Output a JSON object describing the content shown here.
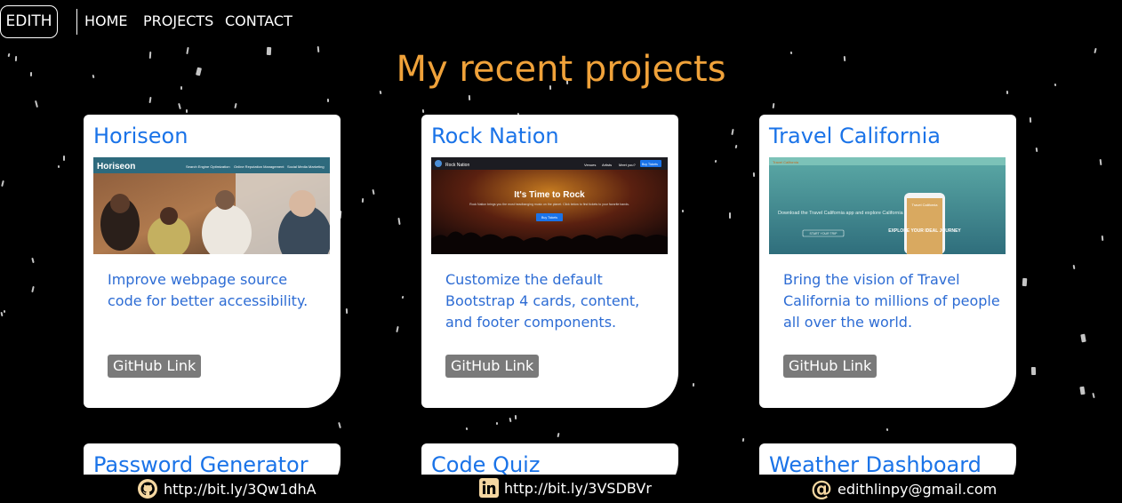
{
  "nav": {
    "brand": "EDITH",
    "links": [
      "HOME",
      "PROJECTS",
      "CONTACT"
    ]
  },
  "main": {
    "title": "My recent projects",
    "projects": [
      {
        "title": "Horiseon",
        "description": "Improve webpage source code for better accessibility.",
        "link_label": "GitHub Link",
        "thumb": {
          "header": "Horiseon",
          "menu": [
            "Search Engine Optimization",
            "Online Reputation Management",
            "Social Media Marketing"
          ]
        }
      },
      {
        "title": "Rock Nation",
        "description": "Customize the default Bootstrap 4 cards, content, and footer components.",
        "link_label": "GitHub Link",
        "thumb": {
          "header": "Rock Nation",
          "menu": [
            "Venues",
            "Artists",
            "Meet you?",
            "Buy Tickets"
          ],
          "headline": "It's Time to Rock",
          "body": "Rock Nation brings you the most headbanging music on the planet. Click below to find tickets to your favorite bands.",
          "button": "Buy Tickets"
        }
      },
      {
        "title": "Travel California",
        "description": "Bring the vision of Travel California to millions of people all over the world.",
        "link_label": "GitHub Link",
        "thumb": {
          "header": "Travel California",
          "body": "Download the Travel California app and explore California today",
          "button": "START YOUR TRIP",
          "phone_title": "Travel California",
          "phone_text": "EXPLORE YOUR IDEAL JOURNEY"
        }
      },
      {
        "title": "Password Generator"
      },
      {
        "title": "Code Quiz"
      },
      {
        "title": "Weather Dashboard"
      }
    ]
  },
  "footer": {
    "github": "http://bit.ly/3Qw1dhA",
    "linkedin": "http://bit.ly/3VSDBVr",
    "email": "edithlinpy@gmail.com"
  },
  "colors": {
    "title": "#f0a23a",
    "card_title": "#1a73e8",
    "card_text": "#2d6cd4",
    "button": "#7a7a7a",
    "footer_icon": "#f5d7a1"
  }
}
